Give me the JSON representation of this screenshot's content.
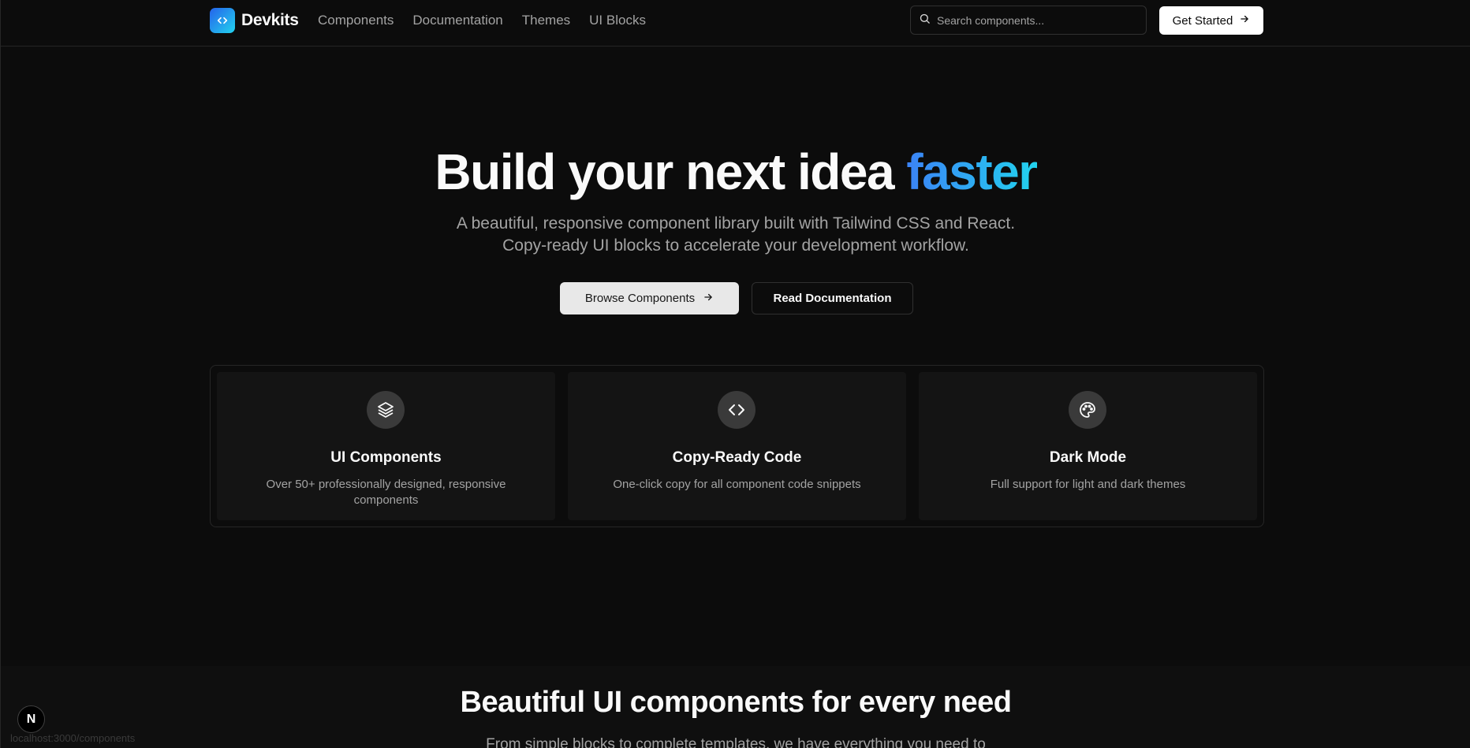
{
  "header": {
    "brand_name": "Devkits",
    "nav": [
      "Components",
      "Documentation",
      "Themes",
      "UI Blocks"
    ],
    "search_placeholder": "Search components...",
    "cta_label": "Get Started"
  },
  "hero": {
    "title_main": "Build your next idea",
    "title_accent": "faster",
    "subtitle_line1": "A beautiful, responsive component library built with Tailwind CSS and React.",
    "subtitle_line2": "Copy-ready UI blocks to accelerate your development workflow.",
    "primary_button": "Browse Components",
    "secondary_button": "Read Documentation"
  },
  "features": [
    {
      "icon": "layers-icon",
      "title": "UI Components",
      "description": "Over 50+ professionally designed, responsive components"
    },
    {
      "icon": "code-icon",
      "title": "Copy-Ready Code",
      "description": "One-click copy for all component code snippets"
    },
    {
      "icon": "palette-icon",
      "title": "Dark Mode",
      "description": "Full support for light and dark themes"
    }
  ],
  "section2": {
    "title": "Beautiful UI components for every need",
    "subtitle": "From simple blocks to complete templates, we have everything you need to"
  },
  "overlay": {
    "next_badge": "N",
    "status_url": "localhost:3000/components"
  },
  "colors": {
    "background": "#0c0c0c",
    "accent_start": "#3b82f6",
    "accent_end": "#22d3ee"
  }
}
